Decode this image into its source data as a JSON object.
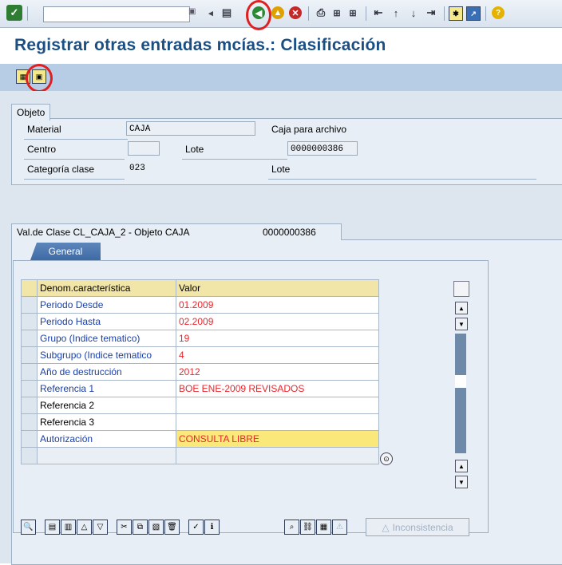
{
  "toolbar": {
    "command_field_value": "",
    "icons": [
      "enter-icon",
      "dropdown-icon",
      "back-arrow-icon",
      "save-icon",
      "back-icon",
      "exit-icon",
      "cancel-icon",
      "print-icon",
      "find-icon",
      "find-next-icon",
      "first-page-icon",
      "prev-page-icon",
      "next-page-icon",
      "last-page-icon",
      "new-session-icon",
      "shortcut-icon",
      "help-icon"
    ]
  },
  "title": "Registrar otras entradas mcías.: Clasificación",
  "objeto": {
    "tab_label": "Objeto",
    "material_label": "Material",
    "material_value": "CAJA",
    "material_desc": "Caja para archivo",
    "centro_label": "Centro",
    "centro_value": "",
    "lote_label": "Lote",
    "lote_value": "0000000386",
    "categoria_label": "Categoría clase",
    "categoria_value": "023",
    "categoria_desc": "Lote"
  },
  "valclase": {
    "header_left": "Val.de Clase CL_CAJA_2 - Objeto CAJA",
    "header_right": "0000000386",
    "tab_label": "General"
  },
  "table": {
    "headers": [
      "Denom.característica",
      "Valor"
    ],
    "rows": [
      {
        "name": "Periodo Desde",
        "value": "01.2009"
      },
      {
        "name": "Periodo Hasta",
        "value": "02.2009"
      },
      {
        "name": "Grupo (Indice tematico)",
        "value": "19"
      },
      {
        "name": "Subgrupo (Indice tematico",
        "value": "4"
      },
      {
        "name": "Año de destrucción",
        "value": "2012"
      },
      {
        "name": "Referencia 1",
        "value": "BOE ENE-2009 REVISADOS"
      },
      {
        "name": "Referencia 2",
        "value": ""
      },
      {
        "name": "Referencia 3",
        "value": ""
      },
      {
        "name": "Autorización",
        "value": "CONSULTA LIBRE"
      },
      {
        "name": "",
        "value": ""
      }
    ]
  },
  "bottom": {
    "inconsistencia_label": "Inconsistencia"
  },
  "colors": {
    "accent_blue": "#1b4e83",
    "value_red": "#e8262b",
    "highlight_circle": "#e02020"
  }
}
